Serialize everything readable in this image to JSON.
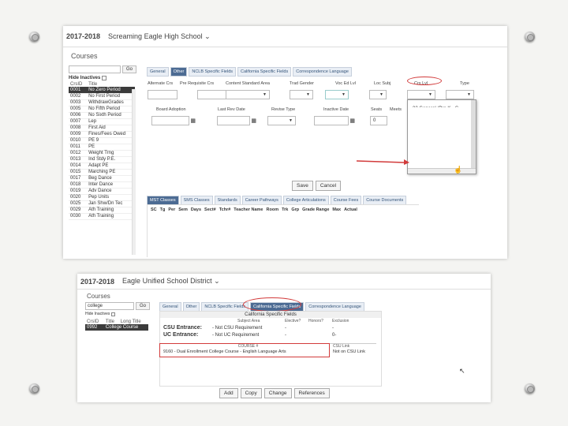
{
  "shot1": {
    "year": "2017-2018",
    "school": "Screaming Eagle High School",
    "section": "Courses",
    "go_label": "Go",
    "hide_inactives": "Hide Inactives",
    "list_headers": [
      "CrsID",
      "Title"
    ],
    "courses": [
      [
        "0001",
        "No Zero Period"
      ],
      [
        "0002",
        "No First Period"
      ],
      [
        "0003",
        "WithdrawGrades"
      ],
      [
        "0005",
        "No Fifth Period"
      ],
      [
        "0006",
        "No Sixth Period"
      ],
      [
        "0007",
        "Lep"
      ],
      [
        "0008",
        "First Aid"
      ],
      [
        "0009",
        "Fines/Fees Owed"
      ],
      [
        "0010",
        "PE 9"
      ],
      [
        "0011",
        "PE"
      ],
      [
        "0012",
        "Weight Trng"
      ],
      [
        "0013",
        "Ind Stdy P.E."
      ],
      [
        "0014",
        "Adapt PE"
      ],
      [
        "0015",
        "Marching PE"
      ],
      [
        "0017",
        "Beg Dance"
      ],
      [
        "0018",
        "Inter Dance"
      ],
      [
        "0019",
        "Adv Dance"
      ],
      [
        "0020",
        "Pep Units"
      ],
      [
        "0025",
        "Jan Shw/Dn Tec"
      ],
      [
        "0029",
        "Ath Training"
      ],
      [
        "0030",
        "Ath Training"
      ]
    ],
    "tabs": [
      "General",
      "Other",
      "NCLB Specific Fields",
      "California Specific Fields",
      "Correspondence Language"
    ],
    "row1_labels": [
      "Alternate Crs",
      "Pre Requisite Crs",
      "Content Standard Area",
      "Trad Gender",
      "Voc Ed Lvl",
      "Loc Subj",
      "Crs Lvl",
      "Type"
    ],
    "row2_labels": [
      "Board Adoption",
      "Last Rev Date",
      "Revise Type",
      "Inactive Date",
      "Seats",
      "Meets"
    ],
    "seats_value": "0",
    "dropdown_options": [
      "32 General (Pre K - G",
      "33 Gifted and Talente",
      "34 Other Honors (non",
      "35 Remedial (Pre K -",
      "36 Special Education",
      "37 International Bacc",
      "38 International Bacc",
      "39 UC Certified Hono",
      "40 College Level"
    ],
    "save_label": "Save",
    "cancel_label": "Cancel",
    "sub_tabs": [
      "MST Classes",
      "SMS Classes",
      "Standards",
      "Career Pathways",
      "College Articulations",
      "Course Fees",
      "Course Documents"
    ],
    "columns": [
      "SC",
      "Tg",
      "Per",
      "Sem",
      "Days",
      "Sect#",
      "Tchr#",
      "Teacher Name",
      "Room",
      "Trk",
      "Grp",
      "Grade Range",
      "Max",
      "Actual"
    ]
  },
  "shot2": {
    "year": "2017-2018",
    "district": "Eagle Unified School District",
    "section": "Courses",
    "search_value": "college",
    "go_label": "Go",
    "hide_inactives": "Hide Inactives",
    "list_headers": [
      "CrsID",
      "Title",
      "Long Title"
    ],
    "course": [
      "0992",
      "College Course"
    ],
    "tabs": [
      "General",
      "Other",
      "NCLB Specific Fields",
      "California Specific Fields",
      "Correspondence Language"
    ],
    "panel_title": "California Specific Fields",
    "table_headers": [
      "Subject Area",
      "Elective?",
      "Honors?",
      "Exclusion"
    ],
    "rows": [
      {
        "label": "CSU Entrance:",
        "value": "- Not CSU Requirement",
        "elective": "-",
        "honors": "",
        "exclusion": "-"
      },
      {
        "label": "UC Entrance:",
        "value": "- Not UC Requirement",
        "elective": "-",
        "honors": "",
        "exclusion": "0-"
      }
    ],
    "course_code_header": "COURSE #",
    "course_code_value": "9160 - Dual Enrollment College Course - English Language Arts",
    "csu_header": "CSU Link",
    "csu_value": "Not on CSU Link",
    "buttons": [
      "Add",
      "Copy",
      "Change",
      "References"
    ]
  }
}
